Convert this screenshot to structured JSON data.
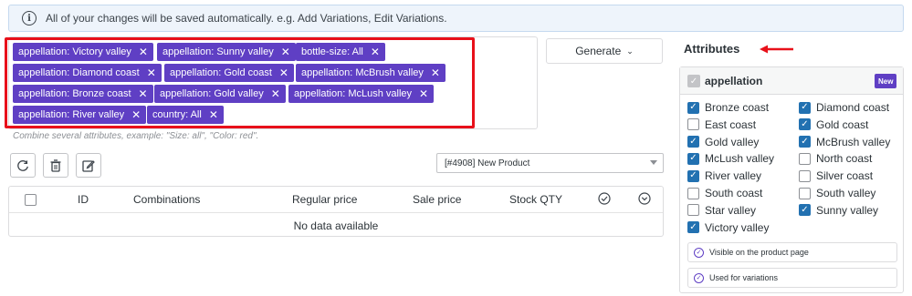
{
  "notice": {
    "text": "All of your changes will be saved automatically. e.g. Add Variations, Edit Variations."
  },
  "tags": [
    {
      "label": "appellation: Victory valley"
    },
    {
      "label": "appellation: Sunny valley"
    },
    {
      "label": "bottle-size: All"
    },
    {
      "label": "appellation: Diamond coast"
    },
    {
      "label": "appellation: Gold coast"
    },
    {
      "label": "appellation: McBrush valley"
    },
    {
      "label": "appellation: Bronze coast"
    },
    {
      "label": "appellation: Gold valley"
    },
    {
      "label": "appellation: McLush valley"
    },
    {
      "label": "appellation: River valley"
    },
    {
      "label": "country: All"
    }
  ],
  "tag_remove_glyph": "✕",
  "hint": "Combine several attributes, example: \"Size: all\", \"Color: red\".",
  "generate_label": "Generate",
  "toolbar": {
    "refresh_icon": "refresh-icon",
    "delete_icon": "trash-icon",
    "edit_icon": "edit-icon"
  },
  "product_select": {
    "value": "[#4908] New Product"
  },
  "table": {
    "headers": {
      "id": "ID",
      "combinations": "Combinations",
      "regular_price": "Regular price",
      "sale_price": "Sale price",
      "stock_qty": "Stock QTY"
    },
    "empty_text": "No data available"
  },
  "attributes": {
    "title": "Attributes",
    "group_name": "appellation",
    "badge": "New",
    "options": [
      {
        "label": "Bronze coast",
        "checked": true
      },
      {
        "label": "Diamond coast",
        "checked": true
      },
      {
        "label": "East coast",
        "checked": false
      },
      {
        "label": "Gold coast",
        "checked": true
      },
      {
        "label": "Gold valley",
        "checked": true
      },
      {
        "label": "McBrush valley",
        "checked": true
      },
      {
        "label": "McLush valley",
        "checked": true
      },
      {
        "label": "North coast",
        "checked": false
      },
      {
        "label": "River valley",
        "checked": true
      },
      {
        "label": "Silver coast",
        "checked": false
      },
      {
        "label": "South coast",
        "checked": false
      },
      {
        "label": "South valley",
        "checked": false
      },
      {
        "label": "Star valley",
        "checked": false
      },
      {
        "label": "Sunny valley",
        "checked": true
      },
      {
        "label": "Victory valley",
        "checked": true
      }
    ],
    "visible_label": "Visible on the product page",
    "variations_label": "Used for variations"
  },
  "colors": {
    "accent": "#5f3fc4",
    "highlight": "#e8101a",
    "checkbox": "#2271b1"
  }
}
